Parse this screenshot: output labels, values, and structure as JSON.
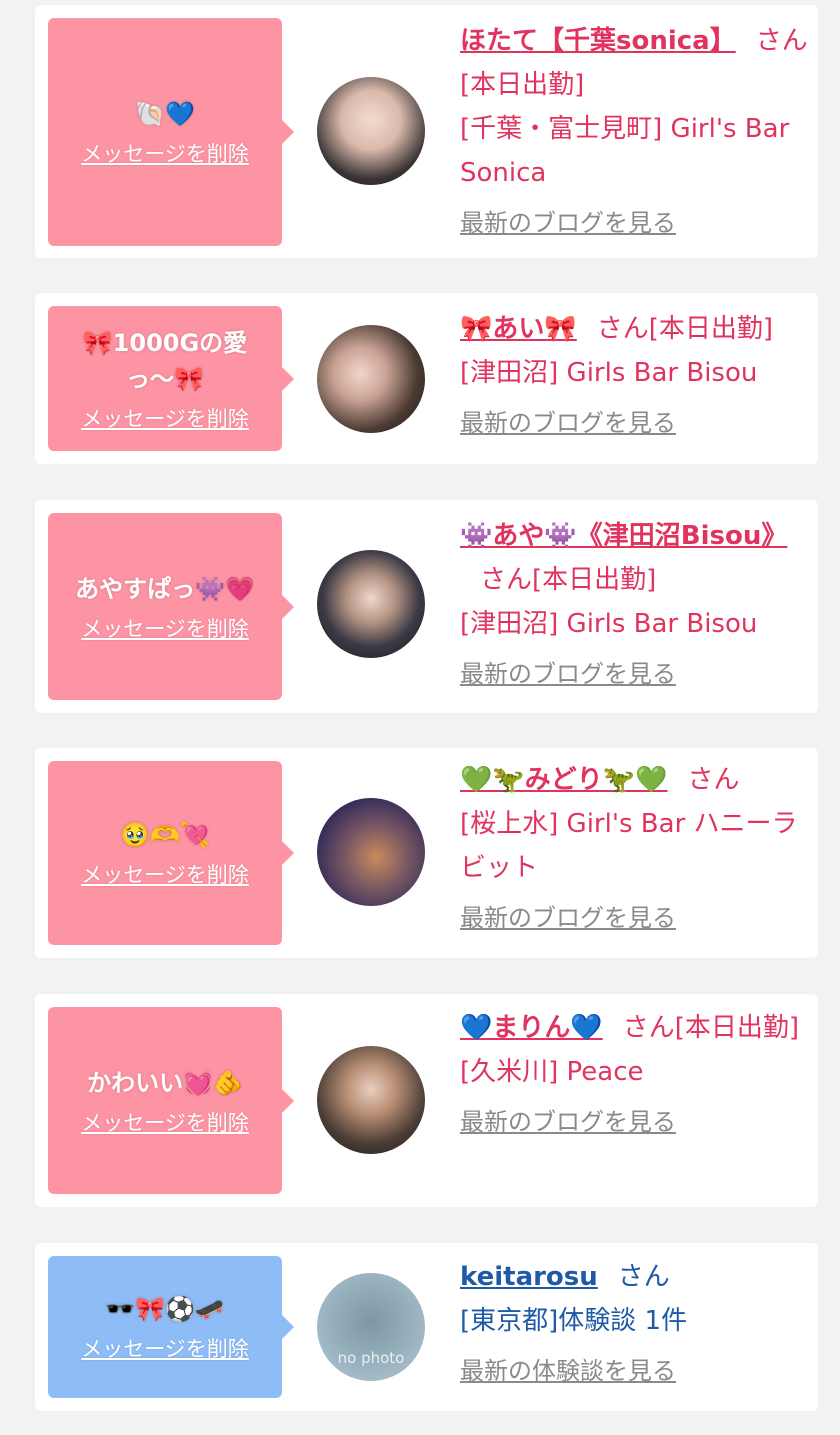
{
  "delete_label": "メッセージを削除",
  "cards": [
    {
      "message": "🐚💙",
      "name": "ほたて【千葉sonica】",
      "suffix": "さん[本日出勤]",
      "shop": "[千葉・富士見町] Girl's Bar Sonica",
      "link": "最新のブログを見る"
    },
    {
      "message": "🎀1000Gの愛っ〜🎀",
      "name": "🎀あい🎀",
      "suffix": "さん[本日出勤]",
      "shop": "[津田沼] Girls Bar Bisou",
      "link": "最新のブログを見る"
    },
    {
      "message": "あやすぱっ👾💗",
      "name": "👾あや👾《津田沼Bisou》",
      "suffix": "さん[本日出勤]",
      "shop": "[津田沼] Girls Bar Bisou",
      "link": "最新のブログを見る"
    },
    {
      "message": "🥹🫶💘",
      "name": "💚🦖みどり🦖💚",
      "suffix": "さん",
      "shop": "[桜上水] Girl's Bar ハニーラビット",
      "link": "最新のブログを見る"
    },
    {
      "message": "かわいい💓🫵",
      "name": "💙まりん💙",
      "suffix": "さん[本日出勤]",
      "shop": "[久米川] Peace",
      "link": "最新のブログを見る"
    },
    {
      "message": "🕶️🎀⚽🛹",
      "name": "keitarosu",
      "suffix": "さん",
      "shop": "[東京都]体験談 1件",
      "link": "最新の体験談を見る",
      "avatar_text": "no photo"
    }
  ],
  "colors": {
    "pink_bubble": "#fd94a4",
    "blue_bubble": "#8ebcf6",
    "name_pink": "#e0345f",
    "name_blue": "#1f5aa6",
    "link_gray": "#8a8a8a"
  }
}
